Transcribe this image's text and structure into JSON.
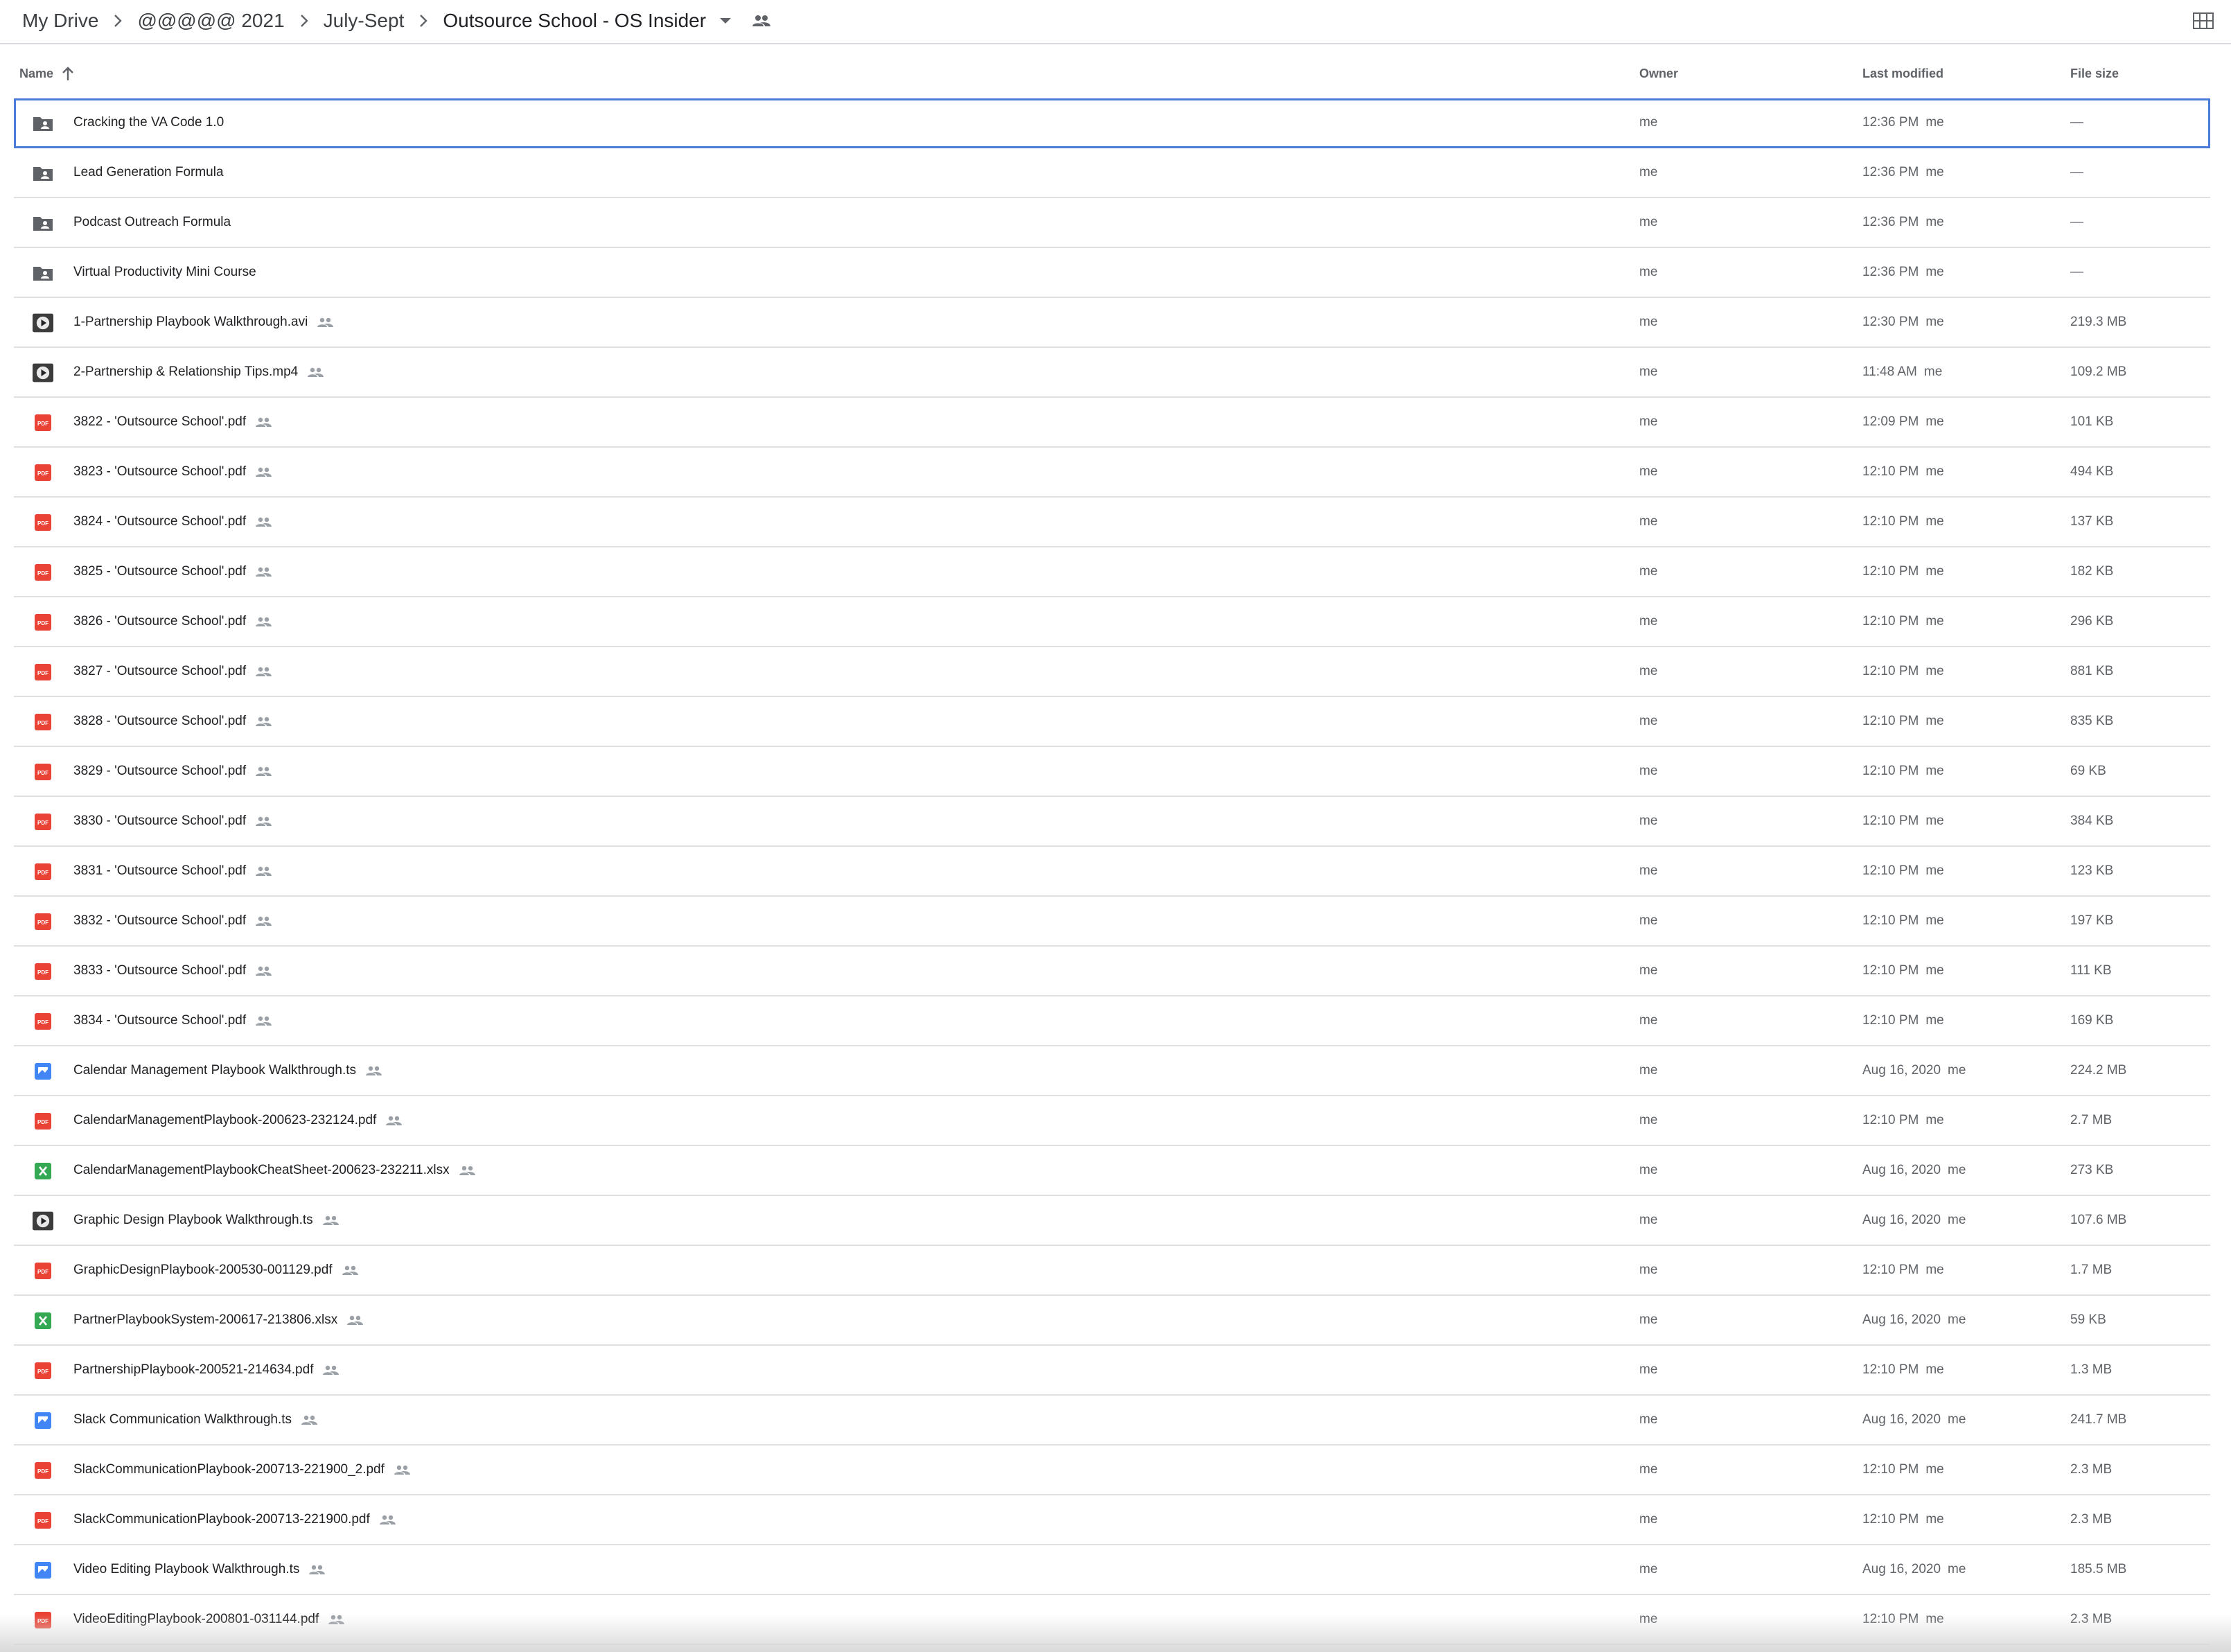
{
  "breadcrumb": {
    "items": [
      "My Drive",
      "@@@@@ 2021",
      "July-Sept",
      "Outsource School - OS Insider"
    ]
  },
  "columns": {
    "name": "Name",
    "owner": "Owner",
    "last_modified": "Last modified",
    "file_size": "File size"
  },
  "colors": {
    "selection": "#4c7bd9",
    "folder": "#5f6368",
    "pdf": "#ea4335",
    "sheet": "#34a853",
    "video_ts": "#4285f4"
  },
  "files": [
    {
      "name": "Cracking the VA Code 1.0",
      "icon": "shared-folder-icon",
      "shared": false,
      "owner": "me",
      "modified": "12:36 PM",
      "modified_by": "me",
      "size": "—",
      "selected": true
    },
    {
      "name": "Lead Generation Formula",
      "icon": "shared-folder-icon",
      "shared": false,
      "owner": "me",
      "modified": "12:36 PM",
      "modified_by": "me",
      "size": "—"
    },
    {
      "name": "Podcast Outreach Formula",
      "icon": "shared-folder-icon",
      "shared": false,
      "owner": "me",
      "modified": "12:36 PM",
      "modified_by": "me",
      "size": "—"
    },
    {
      "name": "Virtual Productivity Mini Course",
      "icon": "shared-folder-icon",
      "shared": false,
      "owner": "me",
      "modified": "12:36 PM",
      "modified_by": "me",
      "size": "—"
    },
    {
      "name": "1-Partnership Playbook Walkthrough.avi",
      "icon": "video-thumbnail-icon",
      "shared": true,
      "owner": "me",
      "modified": "12:30 PM",
      "modified_by": "me",
      "size": "219.3 MB"
    },
    {
      "name": "2-Partnership & Relationship Tips.mp4",
      "icon": "video-thumbnail-icon",
      "shared": true,
      "owner": "me",
      "modified": "11:48 AM",
      "modified_by": "me",
      "size": "109.2 MB"
    },
    {
      "name": "3822 - 'Outsource School'.pdf",
      "icon": "pdf-icon",
      "shared": true,
      "owner": "me",
      "modified": "12:09 PM",
      "modified_by": "me",
      "size": "101 KB"
    },
    {
      "name": "3823 - 'Outsource School'.pdf",
      "icon": "pdf-icon",
      "shared": true,
      "owner": "me",
      "modified": "12:10 PM",
      "modified_by": "me",
      "size": "494 KB"
    },
    {
      "name": "3824 - 'Outsource School'.pdf",
      "icon": "pdf-icon",
      "shared": true,
      "owner": "me",
      "modified": "12:10 PM",
      "modified_by": "me",
      "size": "137 KB"
    },
    {
      "name": "3825 - 'Outsource School'.pdf",
      "icon": "pdf-icon",
      "shared": true,
      "owner": "me",
      "modified": "12:10 PM",
      "modified_by": "me",
      "size": "182 KB"
    },
    {
      "name": "3826 - 'Outsource School'.pdf",
      "icon": "pdf-icon",
      "shared": true,
      "owner": "me",
      "modified": "12:10 PM",
      "modified_by": "me",
      "size": "296 KB"
    },
    {
      "name": "3827 - 'Outsource School'.pdf",
      "icon": "pdf-icon",
      "shared": true,
      "owner": "me",
      "modified": "12:10 PM",
      "modified_by": "me",
      "size": "881 KB"
    },
    {
      "name": "3828 - 'Outsource School'.pdf",
      "icon": "pdf-icon",
      "shared": true,
      "owner": "me",
      "modified": "12:10 PM",
      "modified_by": "me",
      "size": "835 KB"
    },
    {
      "name": "3829 - 'Outsource School'.pdf",
      "icon": "pdf-icon",
      "shared": true,
      "owner": "me",
      "modified": "12:10 PM",
      "modified_by": "me",
      "size": "69 KB"
    },
    {
      "name": "3830 - 'Outsource School'.pdf",
      "icon": "pdf-icon",
      "shared": true,
      "owner": "me",
      "modified": "12:10 PM",
      "modified_by": "me",
      "size": "384 KB"
    },
    {
      "name": "3831 - 'Outsource School'.pdf",
      "icon": "pdf-icon",
      "shared": true,
      "owner": "me",
      "modified": "12:10 PM",
      "modified_by": "me",
      "size": "123 KB"
    },
    {
      "name": "3832 - 'Outsource School'.pdf",
      "icon": "pdf-icon",
      "shared": true,
      "owner": "me",
      "modified": "12:10 PM",
      "modified_by": "me",
      "size": "197 KB"
    },
    {
      "name": "3833 - 'Outsource School'.pdf",
      "icon": "pdf-icon",
      "shared": true,
      "owner": "me",
      "modified": "12:10 PM",
      "modified_by": "me",
      "size": "111 KB"
    },
    {
      "name": "3834 - 'Outsource School'.pdf",
      "icon": "pdf-icon",
      "shared": true,
      "owner": "me",
      "modified": "12:10 PM",
      "modified_by": "me",
      "size": "169 KB"
    },
    {
      "name": "Calendar Management Playbook Walkthrough.ts",
      "icon": "video-file-icon",
      "shared": true,
      "owner": "me",
      "modified": "Aug 16, 2020",
      "modified_by": "me",
      "size": "224.2 MB"
    },
    {
      "name": "CalendarManagementPlaybook-200623-232124.pdf",
      "icon": "pdf-icon",
      "shared": true,
      "owner": "me",
      "modified": "12:10 PM",
      "modified_by": "me",
      "size": "2.7 MB"
    },
    {
      "name": "CalendarManagementPlaybookCheatSheet-200623-232211.xlsx",
      "icon": "spreadsheet-icon",
      "shared": true,
      "owner": "me",
      "modified": "Aug 16, 2020",
      "modified_by": "me",
      "size": "273 KB"
    },
    {
      "name": "Graphic Design Playbook Walkthrough.ts",
      "icon": "video-thumbnail-icon",
      "shared": true,
      "owner": "me",
      "modified": "Aug 16, 2020",
      "modified_by": "me",
      "size": "107.6 MB"
    },
    {
      "name": "GraphicDesignPlaybook-200530-001129.pdf",
      "icon": "pdf-icon",
      "shared": true,
      "owner": "me",
      "modified": "12:10 PM",
      "modified_by": "me",
      "size": "1.7 MB"
    },
    {
      "name": "PartnerPlaybookSystem-200617-213806.xlsx",
      "icon": "spreadsheet-icon",
      "shared": true,
      "owner": "me",
      "modified": "Aug 16, 2020",
      "modified_by": "me",
      "size": "59 KB"
    },
    {
      "name": "PartnershipPlaybook-200521-214634.pdf",
      "icon": "pdf-icon",
      "shared": true,
      "owner": "me",
      "modified": "12:10 PM",
      "modified_by": "me",
      "size": "1.3 MB"
    },
    {
      "name": "Slack Communication Walkthrough.ts",
      "icon": "video-file-icon",
      "shared": true,
      "owner": "me",
      "modified": "Aug 16, 2020",
      "modified_by": "me",
      "size": "241.7 MB"
    },
    {
      "name": "SlackCommunicationPlaybook-200713-221900_2.pdf",
      "icon": "pdf-icon",
      "shared": true,
      "owner": "me",
      "modified": "12:10 PM",
      "modified_by": "me",
      "size": "2.3 MB"
    },
    {
      "name": "SlackCommunicationPlaybook-200713-221900.pdf",
      "icon": "pdf-icon",
      "shared": true,
      "owner": "me",
      "modified": "12:10 PM",
      "modified_by": "me",
      "size": "2.3 MB"
    },
    {
      "name": "Video Editing Playbook Walkthrough.ts",
      "icon": "video-file-icon",
      "shared": true,
      "owner": "me",
      "modified": "Aug 16, 2020",
      "modified_by": "me",
      "size": "185.5 MB"
    },
    {
      "name": "VideoEditingPlaybook-200801-031144.pdf",
      "icon": "pdf-icon",
      "shared": true,
      "owner": "me",
      "modified": "12:10 PM",
      "modified_by": "me",
      "size": "2.3 MB"
    }
  ]
}
